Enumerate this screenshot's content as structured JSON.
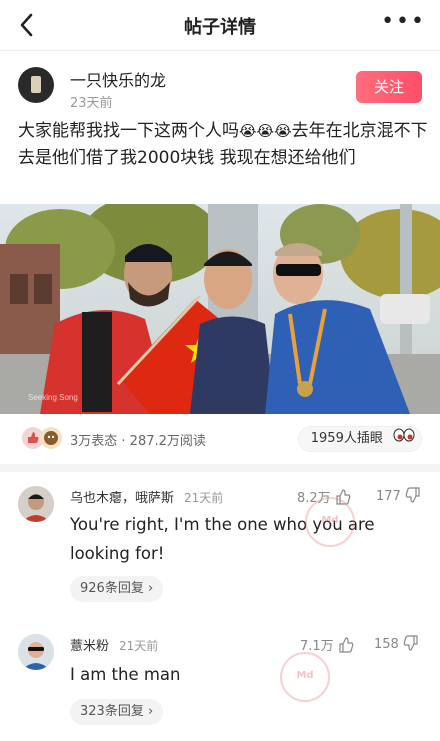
{
  "header": {
    "title": "帖子详情",
    "more": "•••"
  },
  "author": {
    "name": "一只快乐的龙",
    "time": "23天前",
    "follow_label": "关注"
  },
  "post": {
    "text_a": "大家能帮我找一下这两个人吗",
    "emoji": "😭",
    "text_b": "去年在北京混不下去是他们借了我2000块钱  我现在想还给他们"
  },
  "photo": {
    "watermark": "Seeking Song"
  },
  "stats": {
    "summary": "3万表态 · 287.2万阅读",
    "insert_count": "1959人插眼",
    "insert_icon": "eyes-icon"
  },
  "comments": [
    {
      "name": "乌也木瘪，哦萨斯",
      "time": "21天前",
      "likes": "8.2万",
      "dislikes": "177",
      "text": "You're right, I'm the one who you are looking for!",
      "replies": "926条回复",
      "chevron": "›"
    },
    {
      "name": "薏米粉",
      "time": "21天前",
      "likes": "7.1万",
      "dislikes": "158",
      "text": "I am the man",
      "replies": "323条回复",
      "chevron": "›"
    }
  ],
  "colors": {
    "accent": "#ff5a6e",
    "flag": "#de2910"
  }
}
